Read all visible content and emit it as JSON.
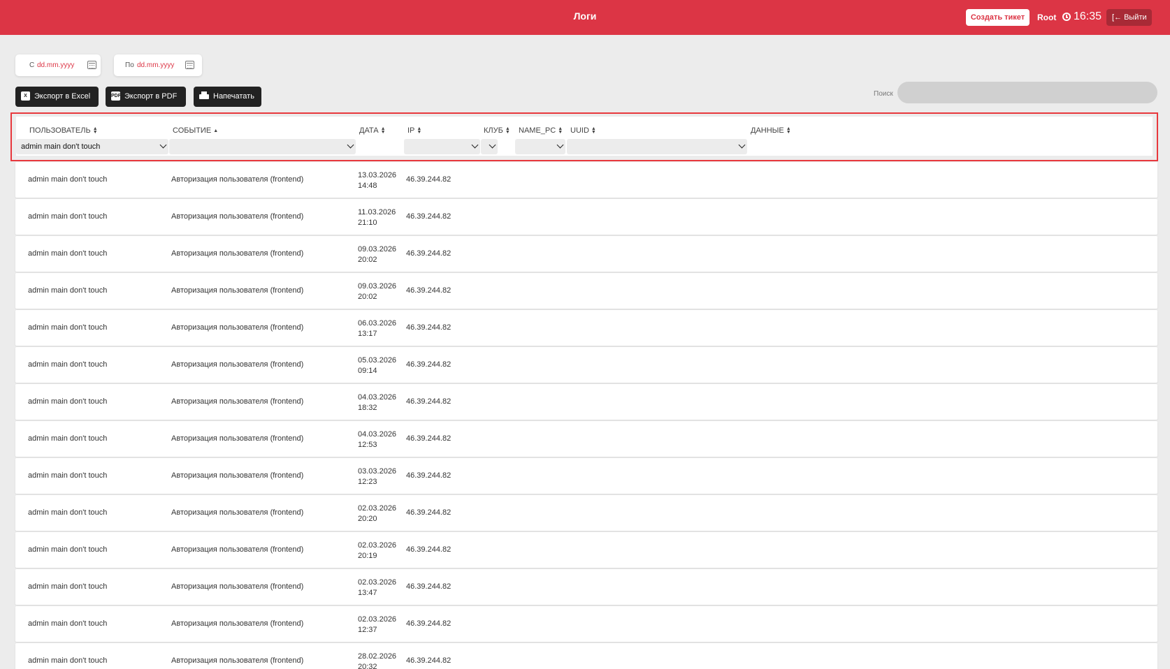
{
  "header": {
    "title": "Логи",
    "create_ticket": "Создать тикет",
    "user": "Root",
    "time": "16:35",
    "logout": "Выйти"
  },
  "date_filters": {
    "from_prefix": "С",
    "from_placeholder": "dd.mm.yyyy",
    "to_prefix": "По",
    "to_placeholder": "dd.mm.yyyy"
  },
  "actions": {
    "export_excel": "Экспорт в Excel",
    "export_pdf": "Экспорт в PDF",
    "print": "Напечатать"
  },
  "search": {
    "label": "Поиск",
    "placeholder": ""
  },
  "table": {
    "columns": [
      {
        "key": "user",
        "label": "ПОЛЬЗОВАТЕЛЬ",
        "filter_value": "admin main don't touch"
      },
      {
        "key": "event",
        "label": "СОБЫТИЕ",
        "filter_value": ""
      },
      {
        "key": "date",
        "label": "ДАТА"
      },
      {
        "key": "ip",
        "label": "IP",
        "filter_value": ""
      },
      {
        "key": "club",
        "label": "КЛУБ",
        "filter_value": ""
      },
      {
        "key": "name_pc",
        "label": "NAME_PC",
        "filter_value": ""
      },
      {
        "key": "uuid",
        "label": "UUID",
        "filter_value": ""
      },
      {
        "key": "data",
        "label": "ДАННЫЕ"
      }
    ],
    "rows": [
      {
        "user": "admin main don't touch",
        "event": "Авторизация пользователя (frontend)",
        "date": "13.03.2026",
        "time": "14:48",
        "ip": "46.39.244.82"
      },
      {
        "user": "admin main don't touch",
        "event": "Авторизация пользователя (frontend)",
        "date": "11.03.2026",
        "time": "21:10",
        "ip": "46.39.244.82"
      },
      {
        "user": "admin main don't touch",
        "event": "Авторизация пользователя (frontend)",
        "date": "09.03.2026",
        "time": "20:02",
        "ip": "46.39.244.82"
      },
      {
        "user": "admin main don't touch",
        "event": "Авторизация пользователя (frontend)",
        "date": "09.03.2026",
        "time": "20:02",
        "ip": "46.39.244.82"
      },
      {
        "user": "admin main don't touch",
        "event": "Авторизация пользователя (frontend)",
        "date": "06.03.2026",
        "time": "13:17",
        "ip": "46.39.244.82"
      },
      {
        "user": "admin main don't touch",
        "event": "Авторизация пользователя (frontend)",
        "date": "05.03.2026",
        "time": "09:14",
        "ip": "46.39.244.82"
      },
      {
        "user": "admin main don't touch",
        "event": "Авторизация пользователя (frontend)",
        "date": "04.03.2026",
        "time": "18:32",
        "ip": "46.39.244.82"
      },
      {
        "user": "admin main don't touch",
        "event": "Авторизация пользователя (frontend)",
        "date": "04.03.2026",
        "time": "12:53",
        "ip": "46.39.244.82"
      },
      {
        "user": "admin main don't touch",
        "event": "Авторизация пользователя (frontend)",
        "date": "03.03.2026",
        "time": "12:23",
        "ip": "46.39.244.82"
      },
      {
        "user": "admin main don't touch",
        "event": "Авторизация пользователя (frontend)",
        "date": "02.03.2026",
        "time": "20:20",
        "ip": "46.39.244.82"
      },
      {
        "user": "admin main don't touch",
        "event": "Авторизация пользователя (frontend)",
        "date": "02.03.2026",
        "time": "20:19",
        "ip": "46.39.244.82"
      },
      {
        "user": "admin main don't touch",
        "event": "Авторизация пользователя (frontend)",
        "date": "02.03.2026",
        "time": "13:47",
        "ip": "46.39.244.82"
      },
      {
        "user": "admin main don't touch",
        "event": "Авторизация пользователя (frontend)",
        "date": "02.03.2026",
        "time": "12:37",
        "ip": "46.39.244.82"
      },
      {
        "user": "admin main don't touch",
        "event": "Авторизация пользователя (frontend)",
        "date": "28.02.2026",
        "time": "20:32",
        "ip": "46.39.244.82"
      }
    ]
  },
  "colors": {
    "brand": "#dc3545",
    "highlight": "#e8383d",
    "background": "#ececec"
  },
  "icons": [
    "clock-icon",
    "logout-icon",
    "calendar-icon",
    "excel-icon",
    "pdf-icon",
    "printer-icon",
    "sort-icon",
    "chevron-down-icon"
  ]
}
